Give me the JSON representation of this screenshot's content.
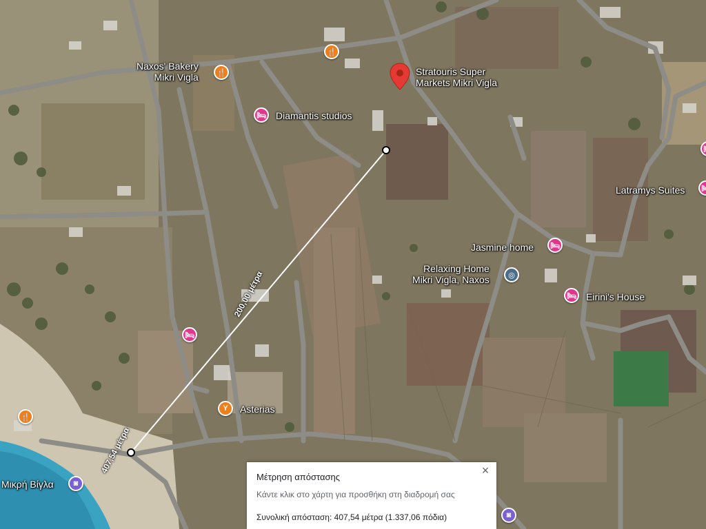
{
  "map": {
    "labels": {
      "bakery": "Naxos' Bakery",
      "bakery_line2": "Mikri Vigla",
      "stratouris": "Stratouris Super",
      "stratouris_line2": "Markets Mikri Vigla",
      "diamantis": "Diamantis studios",
      "latramys": "Latramys Suites",
      "jasmine": "Jasmine home",
      "relaxing": "Relaxing Home",
      "relaxing_line2": "Mikri Vigla, Naxos",
      "eirini": "Eirini's House",
      "asterias": "Asterias",
      "mikri_vigla": "Μικρή Βίγλα"
    },
    "measure_labels": {
      "segment": "200,00 μέτρα",
      "total": "407,54 μέτρα"
    },
    "icons": {
      "food": "fork-knife-icon",
      "hotel": "bed-icon",
      "attraction": "camera-icon",
      "poi": "target-icon",
      "bar": "cocktail-icon",
      "marker": "red-pin-icon"
    },
    "colors": {
      "food": "#ef7f1a",
      "hotel": "#e1368c",
      "attraction": "#7b5fd6",
      "marker": "#e53935",
      "sea": "#3aa3c2"
    }
  },
  "panel": {
    "title": "Μέτρηση απόστασης",
    "hint": "Κάντε κλικ στο χάρτη για προσθήκη στη διαδρομή σας",
    "total": "Συνολική απόσταση: 407,54 μέτρα (1.337,06 πόδια)",
    "close": "×"
  }
}
